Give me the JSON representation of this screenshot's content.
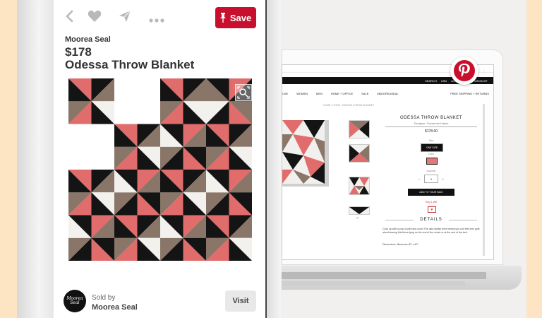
{
  "pin": {
    "save_label": "Save",
    "brand": "Moorea Seal",
    "price": "$178",
    "title": "Odessa Throw Blanket",
    "seller": {
      "sold_by_label": "Sold by",
      "name": "Moorea Seal",
      "avatar_text": "Moorea Seal"
    },
    "visit_label": "Visit",
    "icons": [
      "back-icon",
      "heart-icon",
      "send-icon",
      "more-icon",
      "pushpin-icon",
      "zoom-icon"
    ]
  },
  "website": {
    "header_links": [
      "SEARCH",
      "USD",
      "ACCOUNT",
      "MY WISHLIST"
    ],
    "nav": [
      "USE",
      "WOMEN",
      "MEN",
      "HOME + OFFICE",
      "SALE",
      "#MOOREASEAL"
    ],
    "shipping": "FREE SHIPPING + RETURNS",
    "breadcrumb": "HOME / HOME / ODESSA THROW BLANKET",
    "product": {
      "title": "ODESSA THROW BLANKET",
      "designer": "Designer: Savannah Hayes",
      "price": "$178.00",
      "size_label": "Size",
      "size_value": "ONE SIZE",
      "color_label": "Color",
      "quantity_label": "Quantity",
      "quantity": "1",
      "minus": "−",
      "plus": "+",
      "add_to_bag": "ADD TO YOUR BAG!",
      "only_left": "Only 1 left!",
      "details_heading": "DETAILS",
      "description": "Cozy up with a pop of print and color! The ultra stylish print means you can feel zero guilt about leaving this throw lying on the end of the couch or at the end of the bed.",
      "dimensions": "Dimensions: Measures 60\" x 60\""
    }
  },
  "colors": {
    "pinterest_red": "#c8102e",
    "blanket_coral": "#e06c6c",
    "blanket_taupe": "#8a7668",
    "blanket_black": "#141414",
    "blanket_white": "#f3f1ee",
    "side_peach": "#fde4c2"
  }
}
